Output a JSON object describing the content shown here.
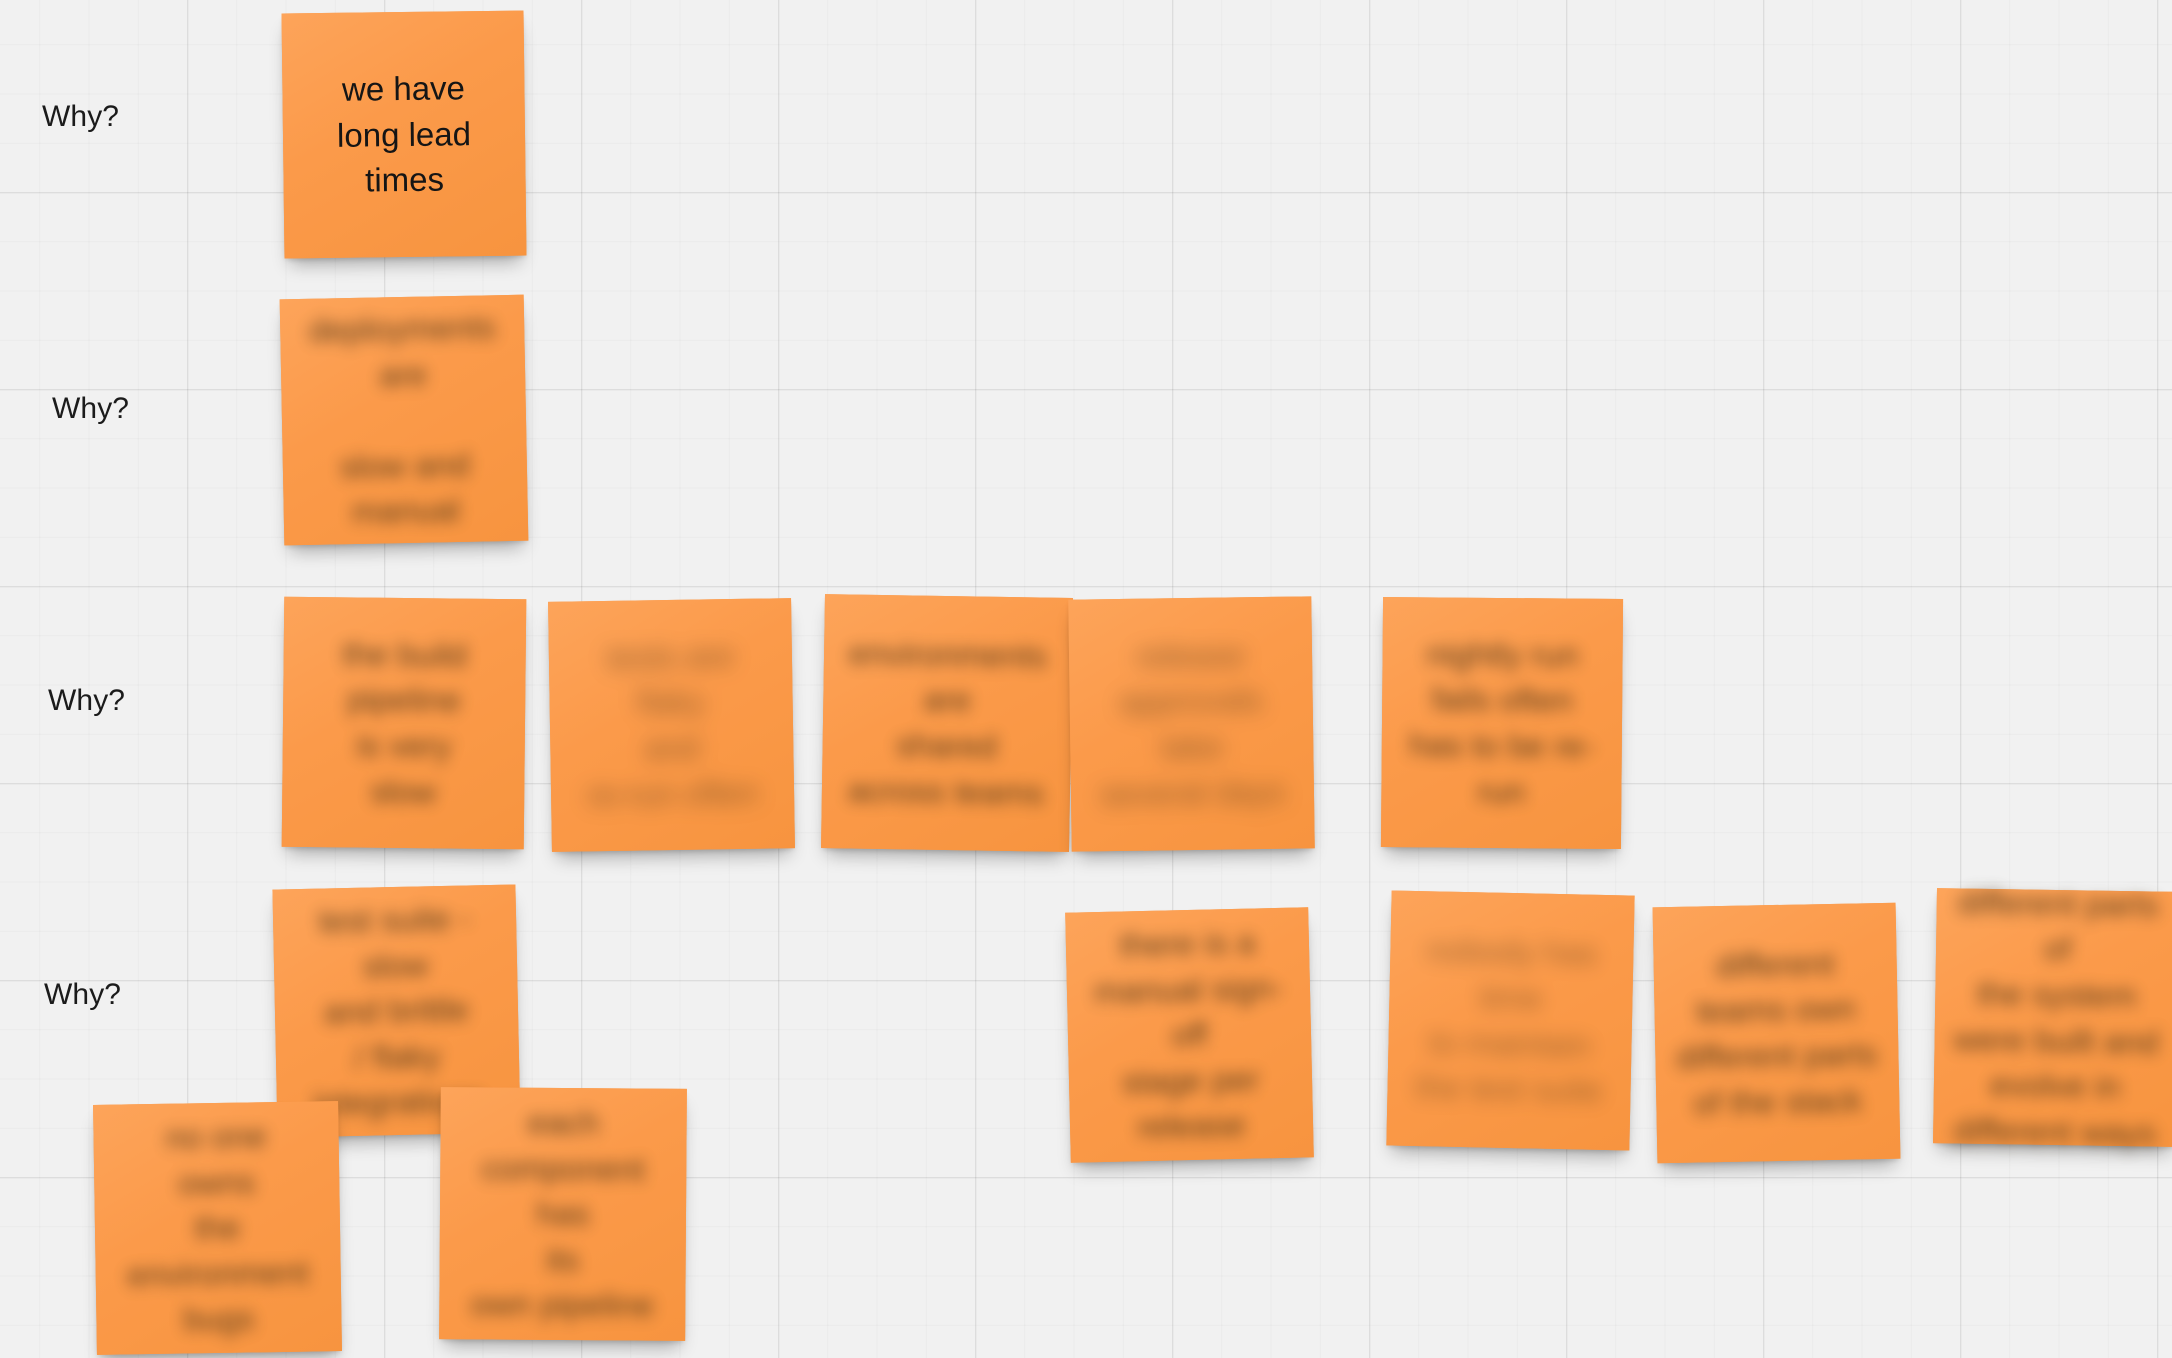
{
  "board": {
    "background_color": "#f1f1f1",
    "grid_minor_color": "#e8e8e8",
    "grid_major_color": "#dedede",
    "note_color": "#fb9a4a",
    "text_color": "#151515"
  },
  "row_labels": [
    {
      "text": "Why?"
    },
    {
      "text": "Why?"
    },
    {
      "text": "Why?"
    },
    {
      "text": "Why?"
    }
  ],
  "notes": [
    {
      "id": "n1",
      "row": 1,
      "text": "we have\nlong lead\ntimes",
      "redacted": false
    },
    {
      "id": "n2",
      "row": 2,
      "text": "deployments are\n\nslow and manual",
      "redacted": true
    },
    {
      "id": "n3",
      "row": 3,
      "text": "the build\npipeline\nis very\nslow",
      "redacted": true
    },
    {
      "id": "n4",
      "row": 3,
      "text": "tests are\nflaky\nand\nre-run often",
      "redacted": true
    },
    {
      "id": "n5",
      "row": 3,
      "text": "environments\nare\nshared\nacross teams",
      "redacted": true
    },
    {
      "id": "n6",
      "row": 3,
      "text": "release\napprovals take\nseveral days",
      "redacted": true
    },
    {
      "id": "n7",
      "row": 3,
      "text": "nightly run\nfails often\nhas to be re-run",
      "redacted": true
    },
    {
      "id": "n8",
      "row": 4,
      "text": "test suite -\nslow\nand brittle\n/ flaky integrations",
      "redacted": true
    },
    {
      "id": "n9",
      "row": 4,
      "text": "no one\nowns\nthe\nenvironment bugs",
      "redacted": true
    },
    {
      "id": "n10",
      "row": 4,
      "text": "each component\nhas\nits\nown pipeline",
      "redacted": true
    },
    {
      "id": "n11",
      "row": 4,
      "text": "there is a\nmanual sign-off\nstage per\nrelease",
      "redacted": true
    },
    {
      "id": "n12",
      "row": 4,
      "text": "nobody has time\nto maintain\nthe test suite",
      "redacted": true
    },
    {
      "id": "n13",
      "row": 4,
      "text": "different\nteams own\ndifferent parts\nof the stack",
      "redacted": true
    },
    {
      "id": "n14",
      "row": 4,
      "text": "different parts of\nthe system\nwere built and\nevolve in different ways",
      "redacted": true
    }
  ]
}
